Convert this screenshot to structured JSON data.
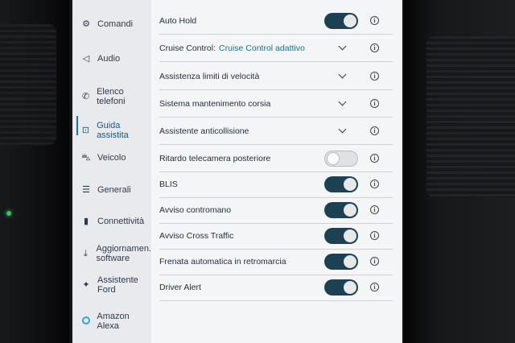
{
  "sidebar": {
    "items": [
      {
        "label": "Comandi",
        "icon": "command-icon"
      },
      {
        "label": "Audio",
        "icon": "speaker-icon"
      },
      {
        "label": "Elenco telefoni",
        "icon": "phone-icon"
      },
      {
        "label": "Guida assistita",
        "icon": "driver-assist-icon",
        "active": true
      },
      {
        "label": "Veicolo",
        "icon": "car-icon"
      },
      {
        "label": "Generali",
        "icon": "sliders-icon"
      },
      {
        "label": "Connettività",
        "icon": "signal-icon"
      },
      {
        "label_line1": "Aggiornamen.",
        "label_line2": "software",
        "icon": "download-icon"
      },
      {
        "label_line1": "Assistente",
        "label_line2": "Ford",
        "icon": "assistant-icon"
      },
      {
        "label": "Amazon Alexa",
        "icon": "alexa-icon"
      }
    ]
  },
  "settings": {
    "rows": [
      {
        "label": "Auto Hold",
        "control": "toggle",
        "on": true
      },
      {
        "label": "Cruise Control:",
        "value": "Cruise Control adattivo",
        "control": "dropdown"
      },
      {
        "label": "Assistenza limiti di velocità",
        "control": "dropdown"
      },
      {
        "label": "Sistema mantenimento corsia",
        "control": "dropdown"
      },
      {
        "label": "Assistente anticollisione",
        "control": "dropdown"
      },
      {
        "label": "Ritardo telecamera posteriore",
        "control": "toggle",
        "on": false
      },
      {
        "label": "BLIS",
        "control": "toggle",
        "on": true
      },
      {
        "label": "Avviso contromano",
        "control": "toggle",
        "on": true
      },
      {
        "label": "Avviso Cross Traffic",
        "control": "toggle",
        "on": true
      },
      {
        "label": "Frenata automatica in retromarcia",
        "control": "toggle",
        "on": true
      },
      {
        "label": "Driver Alert",
        "control": "toggle",
        "on": true
      }
    ],
    "info_glyph": "i"
  },
  "colors": {
    "toggle_on": "#1d4152",
    "accent": "#1b6ea3",
    "value_text": "#1f6f8c"
  }
}
